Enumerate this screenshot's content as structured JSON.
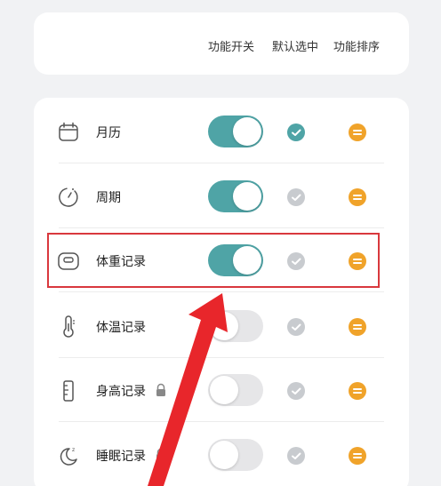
{
  "header": {
    "columns": [
      "功能开关",
      "默认选中",
      "功能排序"
    ]
  },
  "rows": [
    {
      "label": "月历",
      "icon": "calendar-icon",
      "toggle_on": true,
      "default_selected": true,
      "locked": false
    },
    {
      "label": "周期",
      "icon": "cycle-icon",
      "toggle_on": true,
      "default_selected": false,
      "locked": false
    },
    {
      "label": "体重记录",
      "icon": "scale-icon",
      "toggle_on": true,
      "default_selected": false,
      "locked": false
    },
    {
      "label": "体温记录",
      "icon": "thermometer-icon",
      "toggle_on": false,
      "default_selected": false,
      "locked": false
    },
    {
      "label": "身高记录",
      "icon": "ruler-icon",
      "toggle_on": false,
      "default_selected": false,
      "locked": true
    },
    {
      "label": "睡眠记录",
      "icon": "moon-icon",
      "toggle_on": false,
      "default_selected": false,
      "locked": true
    }
  ],
  "colors": {
    "accent": "#4fa4a6",
    "sort": "#f0a32a",
    "highlight": "#d9383d"
  }
}
